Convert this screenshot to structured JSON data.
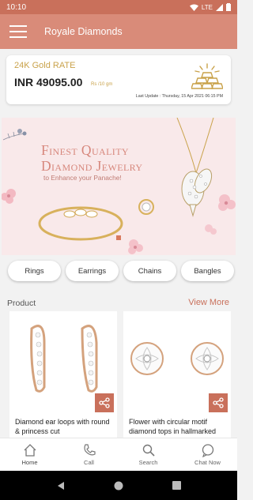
{
  "status": {
    "time": "10:10",
    "network": "LTE"
  },
  "app_bar": {
    "title": "Royale Diamonds"
  },
  "rate_card": {
    "title": "24K Gold RATE",
    "value": "INR 49095.00",
    "unit": "Rs /10 gm",
    "last_update": "Last Update : Thursday, 15 Apr 2021 06:15 PM"
  },
  "banner": {
    "line1": "Finest Quality",
    "line2": "Diamond Jewelry",
    "line3": "to Enhance your Panache!"
  },
  "categories": [
    "Rings",
    "Earrings",
    "Chains",
    "Bangles"
  ],
  "section": {
    "title": "Product",
    "view_more": "View More"
  },
  "products": [
    {
      "name": "Diamond ear loops with round & princess cut"
    },
    {
      "name": "Flower with circular motif diamond tops in hallmarked"
    }
  ],
  "bottom_nav": [
    "Home",
    "Call",
    "Search",
    "Chat Now"
  ],
  "colors": {
    "primary": "#d98b79",
    "status": "#c9705b",
    "gold": "#c9a24a"
  }
}
